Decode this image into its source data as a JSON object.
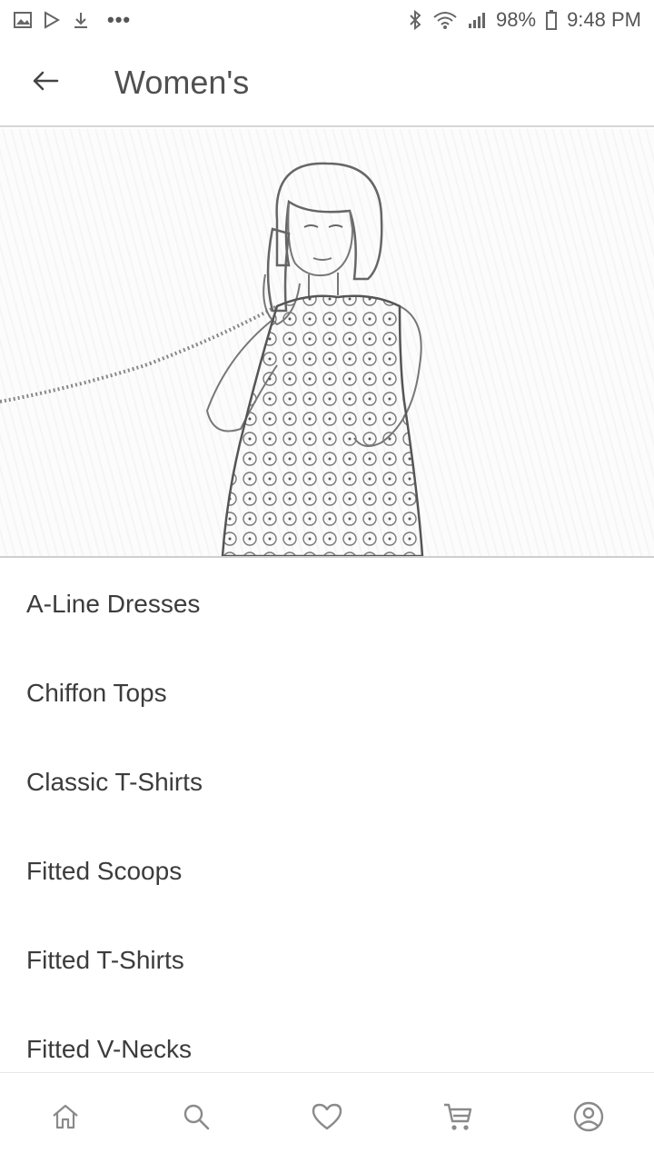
{
  "status_bar": {
    "battery": "98%",
    "time": "9:48 PM",
    "left_icons": [
      "image-icon",
      "play-store-icon",
      "download-icon",
      "more-dots-icon"
    ],
    "right_icons": [
      "bluetooth-icon",
      "wifi-icon",
      "signal-icon",
      "battery-icon"
    ]
  },
  "app_bar": {
    "title": "Women's",
    "back_icon": "arrow-left-icon"
  },
  "hero": {
    "icon": "woman-on-phone-illustration"
  },
  "categories": [
    {
      "label": "A-Line Dresses"
    },
    {
      "label": "Chiffon Tops"
    },
    {
      "label": "Classic T-Shirts"
    },
    {
      "label": "Fitted Scoops"
    },
    {
      "label": "Fitted T-Shirts"
    },
    {
      "label": "Fitted V-Necks"
    }
  ],
  "bottom_nav": {
    "items": [
      "home-icon",
      "search-icon",
      "heart-icon",
      "cart-icon",
      "account-icon"
    ]
  },
  "colors": {
    "text": "#3c3c3c",
    "icon": "#8a8a8a",
    "divider": "#d6d6d6",
    "background": "#ffffff"
  }
}
